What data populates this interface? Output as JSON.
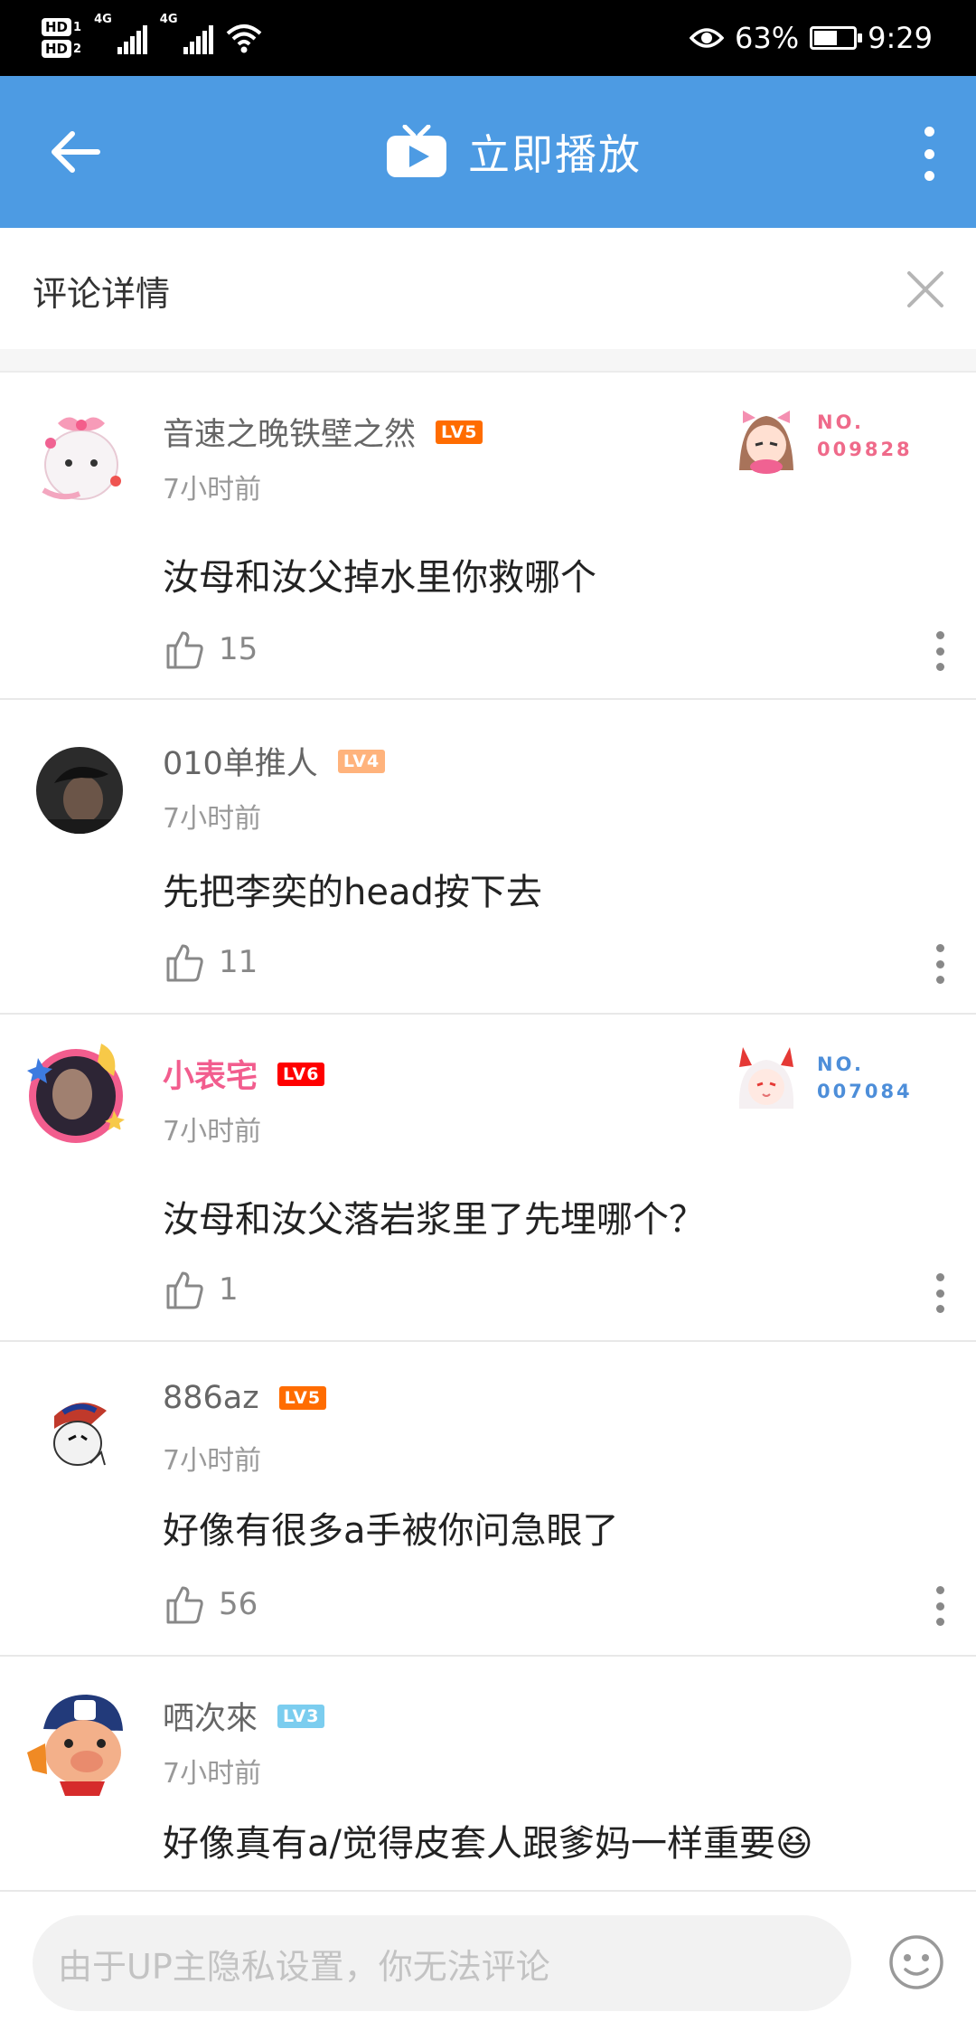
{
  "status_bar": {
    "hd1": "HD",
    "hd2": "HD",
    "sim1": "1",
    "sim2": "2",
    "net1": "4G",
    "net2": "4G",
    "battery_percent": "63%",
    "battery_level": 0.63,
    "time": "9:29"
  },
  "top_bar": {
    "title": "立即播放"
  },
  "detail": {
    "title": "评论详情"
  },
  "comments": [
    {
      "username": "音速之晚铁壁之然",
      "level": "LV5",
      "level_color": "#ff6c00",
      "time": "7小时前",
      "text": "汝母和汝父掉水里你救哪个",
      "likes": "15",
      "badge_no": [
        "NO.",
        "009828"
      ],
      "badge_color": "#ef6a8a",
      "vip": false
    },
    {
      "username": "010单推人",
      "level": "LV4",
      "level_color": "#ffb37c",
      "time": "7小时前",
      "text": "先把李奕的head按下去",
      "likes": "11",
      "vip": false
    },
    {
      "username": "小表宅",
      "level": "LV6",
      "level_color": "#ff0000",
      "time": "7小时前",
      "text": "汝母和汝父落岩浆里了先埋哪个？",
      "likes": "1",
      "badge_no": [
        "NO.",
        "007084"
      ],
      "badge_color": "#4d8ed9",
      "vip": true
    },
    {
      "username": "886az",
      "level": "LV5",
      "level_color": "#ff6c00",
      "time": "7小时前",
      "text": "好像有很多a手被你问急眼了",
      "likes": "56",
      "vip": false
    },
    {
      "username": "哂次來",
      "level": "LV3",
      "level_color": "#7bcdef",
      "time": "7小时前",
      "text": "好像真有a/觉得皮套人跟爹妈一样重要😆",
      "vip": false
    }
  ],
  "bottom": {
    "placeholder": "由于UP主隐私设置，你无法评论"
  }
}
